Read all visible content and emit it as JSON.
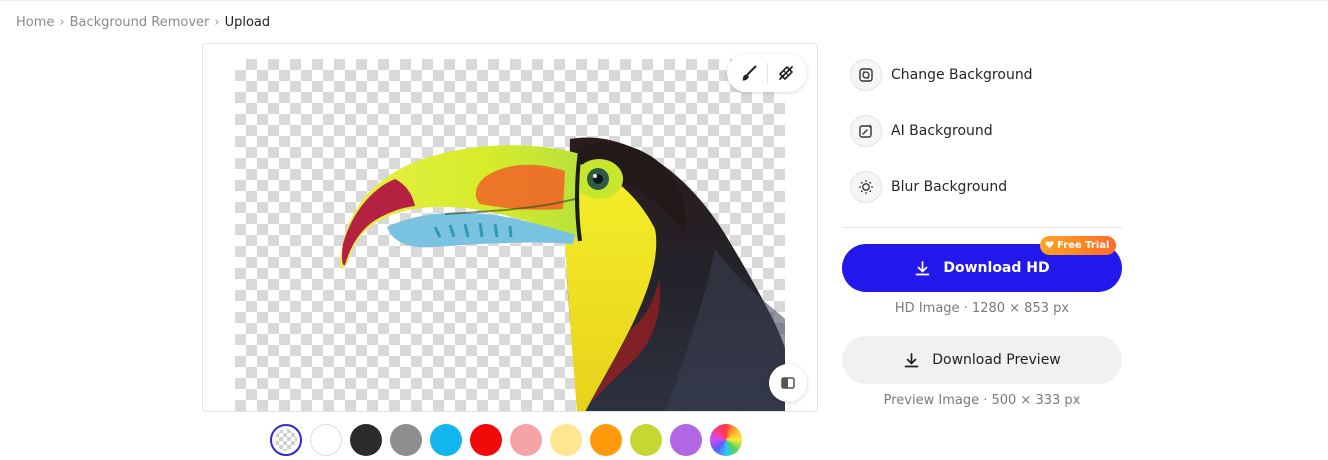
{
  "breadcrumb": {
    "home": "Home",
    "section": "Background Remover",
    "current": "Upload",
    "separator": "›"
  },
  "editor": {
    "tools": [
      {
        "name": "brush-icon",
        "label": "Brush"
      },
      {
        "name": "erase-restore-icon",
        "label": "Eraser"
      }
    ],
    "compare_icon": "compare-icon",
    "image_subject": "toucan"
  },
  "swatches": [
    {
      "name": "transparent",
      "color": "transparent",
      "selected": true
    },
    {
      "name": "white",
      "color": "#ffffff"
    },
    {
      "name": "black",
      "color": "#2b2b2b"
    },
    {
      "name": "gray",
      "color": "#8e8e8e"
    },
    {
      "name": "sky-blue",
      "color": "#12b6ee"
    },
    {
      "name": "red",
      "color": "#f00a0a"
    },
    {
      "name": "pink",
      "color": "#f6a3a7"
    },
    {
      "name": "light-yellow",
      "color": "#fde68f"
    },
    {
      "name": "orange",
      "color": "#ff9a0a"
    },
    {
      "name": "lime",
      "color": "#c6d733"
    },
    {
      "name": "purple",
      "color": "#b167e3"
    },
    {
      "name": "rainbow",
      "color": "conic-gradient"
    }
  ],
  "side": {
    "options": [
      {
        "label": "Change Background",
        "icon": "change-background-icon"
      },
      {
        "label": "AI Background",
        "icon": "ai-background-icon"
      },
      {
        "label": "Blur Background",
        "icon": "blur-background-icon"
      }
    ],
    "download_hd": {
      "label": "Download HD",
      "badge": "Free Trial",
      "caption": "HD Image · 1280 × 853 px"
    },
    "download_preview": {
      "label": "Download Preview",
      "caption": "Preview Image · 500 × 333 px"
    }
  },
  "colors": {
    "primary": "#2318ec",
    "badge_gradient_start": "#ffa51f",
    "badge_gradient_end": "#ff6a2a",
    "selected_ring": "#2b2bd9"
  }
}
